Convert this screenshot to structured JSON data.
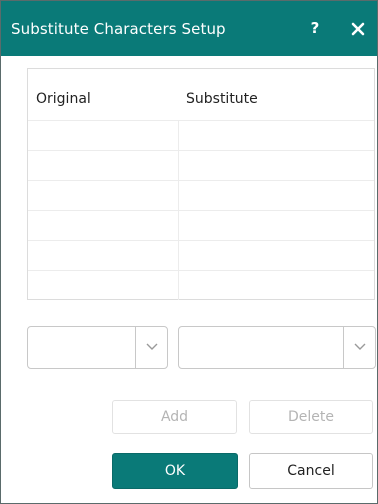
{
  "dialog": {
    "title": "Substitute Characters Setup",
    "help_label": "?",
    "close_icon": "close-icon",
    "colors": {
      "titlebar": "#0a7a78",
      "accent": "#0a7a78"
    }
  },
  "table": {
    "columns": [
      "Original",
      "Substitute"
    ],
    "rows": [
      [
        "",
        ""
      ],
      [
        "",
        ""
      ],
      [
        "",
        ""
      ],
      [
        "",
        ""
      ],
      [
        "",
        ""
      ],
      [
        "",
        ""
      ]
    ]
  },
  "inputs": {
    "original_value": "",
    "substitute_value": "",
    "dropdown_icon": "chevron-down-icon"
  },
  "buttons": {
    "add": "Add",
    "delete": "Delete",
    "ok": "OK",
    "cancel": "Cancel"
  }
}
